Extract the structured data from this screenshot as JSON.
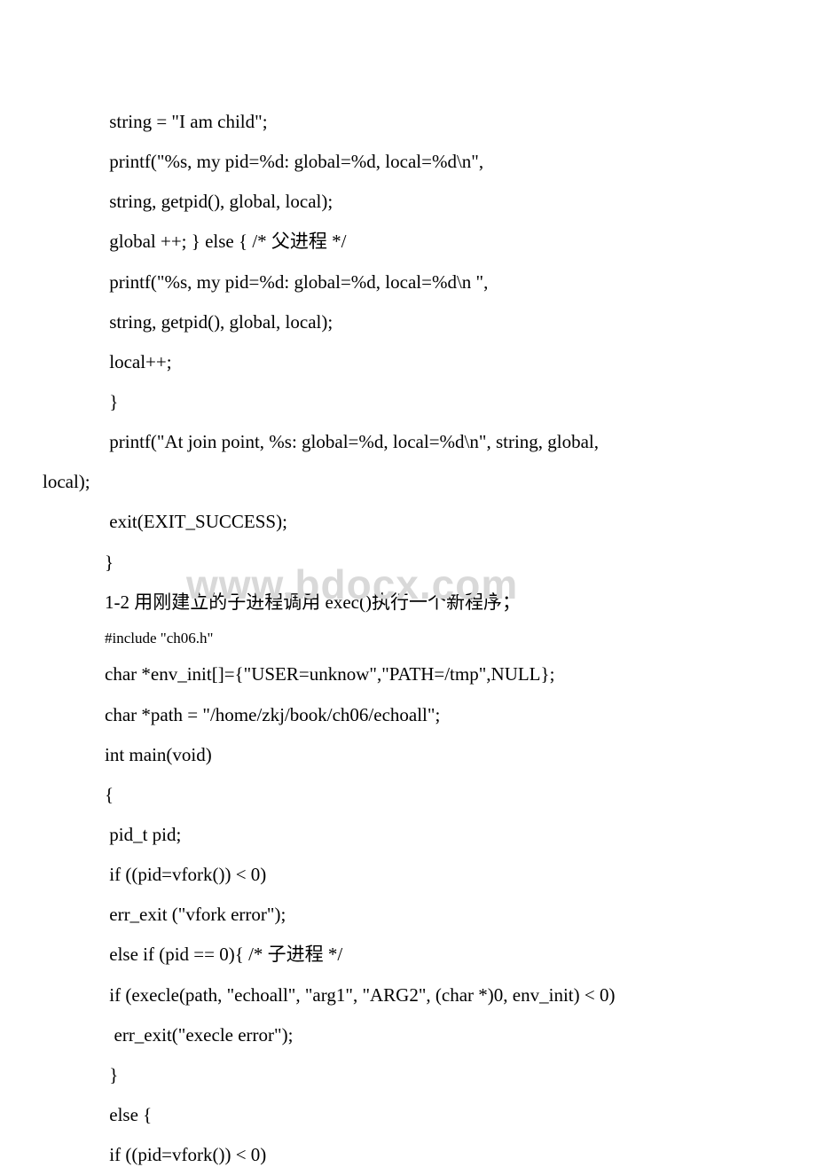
{
  "lines": {
    "l1": " string = \"I am child\";",
    "l2": " printf(\"%s, my pid=%d: global=%d, local=%d\\n\",",
    "l3": " string, getpid(), global, local);",
    "l4": " global ++; } else { /* 父进程 */",
    "l5": " printf(\"%s, my pid=%d: global=%d, local=%d\\n \",",
    "l6": " string, getpid(), global, local);",
    "l7": " local++;",
    "l8": " }",
    "l9a": " printf(\"At join point, %s: global=%d, local=%d\\n\", string, global,",
    "l9b": "local);",
    "l10": " exit(EXIT_SUCCESS);",
    "l11": "}",
    "l12": "1-2 用刚建立的子进程调用 exec()执行一个新程序；",
    "l13": "#include \"ch06.h\"",
    "l14": "char *env_init[]={\"USER=unknow\",\"PATH=/tmp\",NULL};",
    "l15": "char *path = \"/home/zkj/book/ch06/echoall\";",
    "l16": "int main(void)",
    "l17": "{",
    "l18": " pid_t pid;",
    "l19": " if ((pid=vfork()) < 0)",
    "l20": " err_exit (\"vfork error\");",
    "l21": " else if (pid == 0){ /* 子进程 */",
    "l22": " if (execle(path, \"echoall\", \"arg1\", \"ARG2\", (char *)0, env_init) < 0)",
    "l23": "  err_exit(\"execle error\");",
    "l24": " }",
    "l25": " else {",
    "l26": " if ((pid=vfork()) < 0)"
  },
  "watermark": "www.bdocx.com"
}
